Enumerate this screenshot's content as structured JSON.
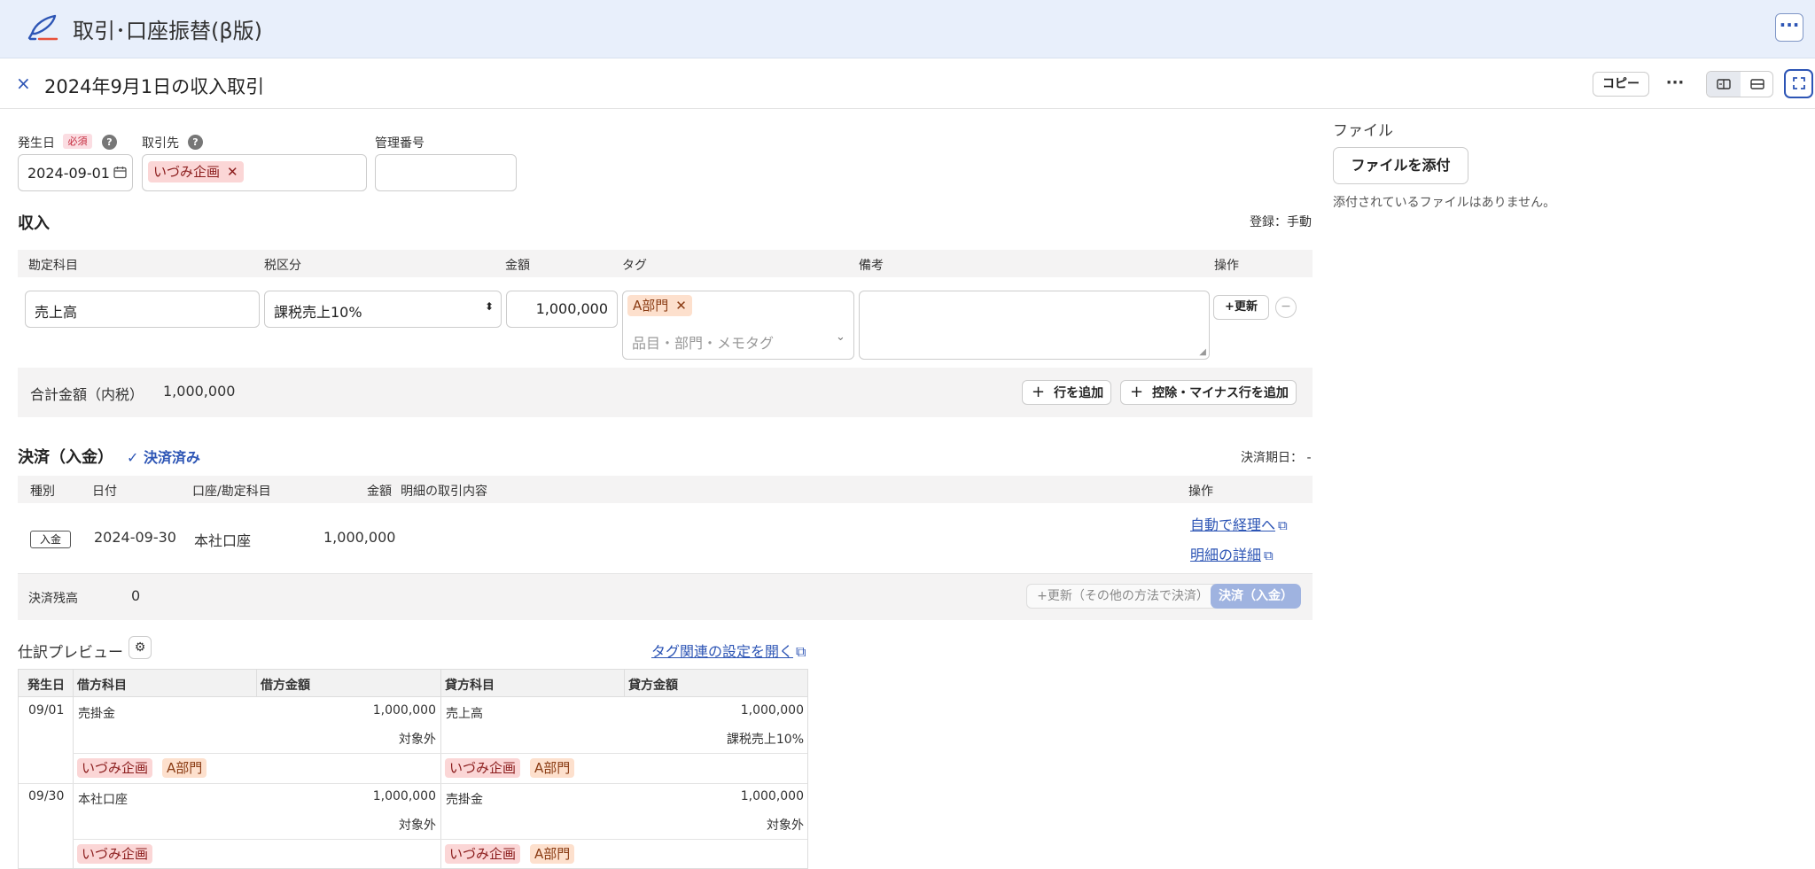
{
  "app": {
    "title": "取引･口座振替(β版)",
    "more_label": "···"
  },
  "header": {
    "title": "2024年9月1日の収入取引",
    "close_icon": "×",
    "copy_label": "コピー",
    "more_label": "···",
    "view_split_icon": "⊟",
    "view_stack_icon": "⊟",
    "expand_icon": "⛶"
  },
  "fields": {
    "date_label": "発生日",
    "required_badge": "必須",
    "help_icon": "?",
    "date_value": "2024-09-01",
    "partner_label": "取引先",
    "partner_chip": "いづみ企画",
    "mgmt_label": "管理番号",
    "mgmt_value": ""
  },
  "income": {
    "title": "収入",
    "registration": "登録：手動",
    "columns": [
      "勘定科目",
      "税区分",
      "金額",
      "タグ",
      "備考",
      "操作"
    ],
    "row": {
      "account": "売上高",
      "tax": "課税売上10%",
      "amount": "1,000,000",
      "tag_chip": "A部門",
      "tag_placeholder": "品目・部門・メモタグ",
      "note": "",
      "update_label": "+更新",
      "remove_label": "−"
    },
    "total_label": "合計金額（内税）",
    "total_value": "1,000,000",
    "add_row_label": "行を追加",
    "add_minus_label": "控除・マイナス行を追加"
  },
  "settlement": {
    "title": "決済（入金）",
    "status": "✓ 決済済み",
    "due": "決済期日： -",
    "columns": [
      "種別",
      "日付",
      "口座/勘定科目",
      "金額",
      "明細の取引内容",
      "操作"
    ],
    "row": {
      "type": "入金",
      "date": "2024-09-30",
      "account": "本社口座",
      "amount": "1,000,000",
      "desc": "",
      "link1": "自動で経理へ",
      "link2": "明細の詳細"
    },
    "balance_label": "決済残高",
    "balance_value": "0",
    "update_other_label": "+更新（その他の方法で決済）",
    "settle_label": "決済（入金）"
  },
  "journal": {
    "title": "仕訳プレビュー",
    "settings_link": "タグ関連の設定を開く",
    "columns": [
      "発生日",
      "借方科目",
      "借方金額",
      "貸方科目",
      "貸方金額"
    ],
    "rows": [
      {
        "date": "09/01",
        "debit_account": "売掛金",
        "debit_amount": "1,000,000",
        "debit_tax": "対象外",
        "credit_account": "売上高",
        "credit_amount": "1,000,000",
        "credit_tax": "課税売上10%",
        "debit_tags": [
          "いづみ企画",
          "A部門"
        ],
        "credit_tags": [
          "いづみ企画",
          "A部門"
        ]
      },
      {
        "date": "09/30",
        "debit_account": "本社口座",
        "debit_amount": "1,000,000",
        "debit_tax": "対象外",
        "credit_account": "売掛金",
        "credit_amount": "1,000,000",
        "credit_tax": "対象外",
        "debit_tags": [
          "いづみ企画"
        ],
        "credit_tags": [
          "いづみ企画",
          "A部門"
        ]
      }
    ]
  },
  "files": {
    "title": "ファイル",
    "attach_label": "ファイルを添付",
    "empty_message": "添付されているファイルはありません。"
  },
  "colors": {
    "accent": "#2d55b5",
    "topbar": "#e8effb",
    "chip_red": "#fbd6d6",
    "chip_orange": "#fde0cd"
  }
}
